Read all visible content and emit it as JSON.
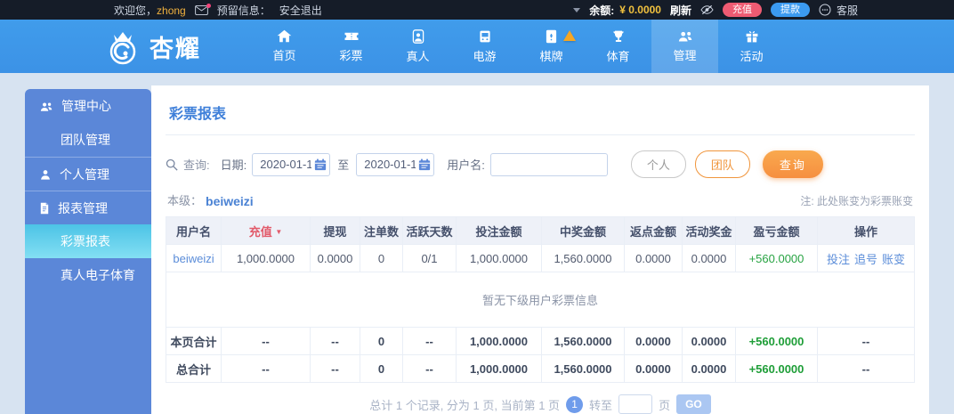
{
  "colors": {
    "topbar_bg": "#151c28",
    "nav_blue": "#3e97e9",
    "sidebar_blue": "#5b87d8",
    "active_cyan": "#5ecdec",
    "accent_orange": "#f68f40",
    "deposit_red": "#ee5b72",
    "withdraw_blue": "#3b9af0",
    "link_blue": "#5b8dd9",
    "profit_green": "#27a342",
    "sorted_red": "#e25a6a",
    "balance_yellow": "#f0c13e",
    "page_bg": "#d7e3f1"
  },
  "topbar": {
    "welcome_prefix": "欢迎您，",
    "username": "zhong",
    "reserved_label": "预留信息：",
    "logout": "安全退出",
    "balance_label": "余额:",
    "balance_value": "¥ 0.0000",
    "refresh": "刷新",
    "deposit": "充值",
    "withdraw": "提款",
    "service": "客服"
  },
  "navbar": {
    "brand": "杏耀",
    "items": [
      {
        "label": "首页"
      },
      {
        "label": "彩票"
      },
      {
        "label": "真人"
      },
      {
        "label": "电游"
      },
      {
        "label": "棋牌",
        "badge": "hot"
      },
      {
        "label": "体育"
      },
      {
        "label": "管理",
        "active": true
      },
      {
        "label": "活动"
      }
    ]
  },
  "sidebar": {
    "items": [
      {
        "label": "管理中心",
        "type": "section"
      },
      {
        "label": "团队管理",
        "type": "sub"
      },
      {
        "label": "个人管理",
        "type": "section"
      },
      {
        "label": "报表管理",
        "type": "section"
      },
      {
        "label": "彩票报表",
        "type": "sub",
        "active": true
      },
      {
        "label": "真人电子体育",
        "type": "sub"
      }
    ]
  },
  "main": {
    "title": "彩票报表",
    "search": {
      "query_label": "查询:",
      "date_label": "日期:",
      "date_from": "2020-01-1",
      "to_label": "至",
      "date_to": "2020-01-1",
      "username_label": "用户名:",
      "username_value": "",
      "personal_btn": "个人",
      "team_btn": "团队",
      "search_btn": "查询"
    },
    "level_label": "本级：",
    "level_value": "beiweizi",
    "note": "注: 此处账变为彩票账变",
    "table": {
      "headers": [
        "用户名",
        "充值",
        "提现",
        "注单数",
        "活跃天数",
        "投注金额",
        "中奖金额",
        "返点金额",
        "活动奖金",
        "盈亏金额",
        "操作"
      ],
      "row": {
        "username": "beiweizi",
        "cells": [
          "1,000.0000",
          "0.0000",
          "0",
          "0/1",
          "1,000.0000",
          "1,560.0000",
          "0.0000",
          "0.0000"
        ],
        "profit": "+560.0000",
        "actions": [
          "投注",
          "追号",
          "账变"
        ]
      },
      "empty_message": "暂无下级用户彩票信息",
      "page_total": {
        "label": "本页合计",
        "cells": [
          "--",
          "--",
          "0",
          "--",
          "1,000.0000",
          "1,560.0000",
          "0.0000",
          "0.0000"
        ],
        "profit": "+560.0000",
        "action": "--"
      },
      "grand_total": {
        "label": "总合计",
        "cells": [
          "--",
          "--",
          "0",
          "--",
          "1,000.0000",
          "1,560.0000",
          "0.0000",
          "0.0000"
        ],
        "profit": "+560.0000",
        "action": "--"
      }
    },
    "pagination": {
      "summary": "总计 1 个记录, 分为 1 页, 当前第 1 页",
      "current_page": "1",
      "goto_label": "转至",
      "page_label": "页",
      "go_btn": "GO"
    }
  }
}
